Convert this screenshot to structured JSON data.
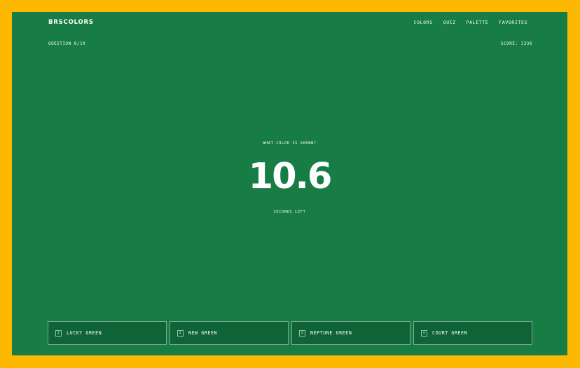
{
  "header": {
    "brand": "BRSCOLORS",
    "nav": [
      "COLORS",
      "QUIZ",
      "PALETTE",
      "FAVORITES"
    ]
  },
  "status": {
    "question": "QUESTION 6/10",
    "score": "SCORE: 1336"
  },
  "quiz": {
    "prompt": "WHAT COLOR IS SHOWN?",
    "timer": "10.6",
    "timer_label": "SECONDS LEFT",
    "answers": [
      {
        "key": "1",
        "label": "LUCKY GREEN"
      },
      {
        "key": "2",
        "label": "NEW GREEN"
      },
      {
        "key": "3",
        "label": "NEPTUNE GREEN"
      },
      {
        "key": "4",
        "label": "COURT GREEN"
      }
    ]
  },
  "colors": {
    "frame": "#FFB800",
    "shown_color": "#177D45",
    "button_bg": "#0F6437",
    "text": "#FFFFFF"
  }
}
